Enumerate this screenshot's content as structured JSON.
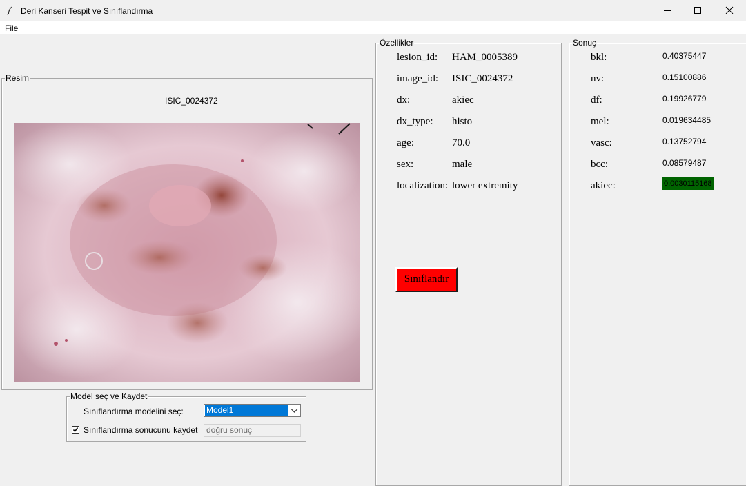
{
  "window": {
    "title": "Deri Kanseri Tespit ve Sınıflandırma",
    "controls": [
      "minimize-icon",
      "maximize-icon",
      "close-icon"
    ]
  },
  "menu": {
    "file": "File"
  },
  "image_panel": {
    "legend": "Resim",
    "caption": "ISIC_0024372"
  },
  "model_panel": {
    "legend": "Model seç ve Kaydet",
    "model_label": "Sınıflandırma modelini seç:",
    "model_selected": "Model1",
    "save_checkbox_label": "Sınıflandırma sonucunu kaydet",
    "save_checked": true,
    "save_entry_value": "doğru sonuç"
  },
  "features_panel": {
    "legend": "Özellikler",
    "rows": [
      {
        "key": "lesion_id:",
        "value": "HAM_0005389"
      },
      {
        "key": "image_id:",
        "value": "ISIC_0024372"
      },
      {
        "key": "dx:",
        "value": "akiec"
      },
      {
        "key": "dx_type:",
        "value": "histo"
      },
      {
        "key": "age:",
        "value": "70.0"
      },
      {
        "key": "sex:",
        "value": "male"
      },
      {
        "key": "localization:",
        "value": "lower extremity"
      }
    ],
    "classify_button": "Sınıflandır",
    "classify_color": "#ff0000"
  },
  "result_panel": {
    "legend": "Sonuç",
    "rows": [
      {
        "key": "bkl:",
        "value": "0.40375447"
      },
      {
        "key": "nv:",
        "value": "0.15100886"
      },
      {
        "key": "df:",
        "value": "0.19926779"
      },
      {
        "key": "mel:",
        "value": "0.019634485"
      },
      {
        "key": "vasc:",
        "value": "0.13752794"
      },
      {
        "key": "bcc:",
        "value": "0.08579487"
      },
      {
        "key": "akiec:",
        "value": "0.0030115168"
      }
    ],
    "highlight_color": "#006400"
  }
}
